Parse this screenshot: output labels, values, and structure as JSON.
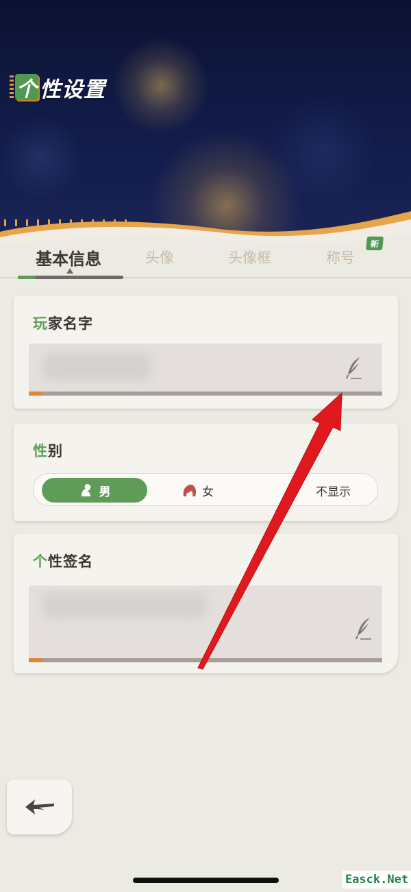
{
  "header": {
    "title_first_char": "个",
    "title_rest": "性设置"
  },
  "tabs": [
    {
      "label": "基本信息",
      "active": true
    },
    {
      "label": "头像",
      "active": false
    },
    {
      "label": "头像框",
      "active": false
    },
    {
      "label": "称号",
      "active": false,
      "badge": "新"
    }
  ],
  "sections": {
    "player_name": {
      "title_first": "玩",
      "title_rest": "家名字"
    },
    "gender": {
      "title_first": "性",
      "title_rest": "别",
      "options": [
        "男",
        "女",
        "不显示"
      ],
      "selected": "男"
    },
    "signature": {
      "title_first": "个",
      "title_rest": "性签名"
    }
  },
  "colors": {
    "accent_green": "#5e9c58",
    "accent_orange": "#e3a048",
    "annotation_red": "#e0191e"
  },
  "icons": [
    "quill-icon",
    "male-icon",
    "female-icon",
    "back-arrow-icon"
  ],
  "watermark": "Easck.Net"
}
